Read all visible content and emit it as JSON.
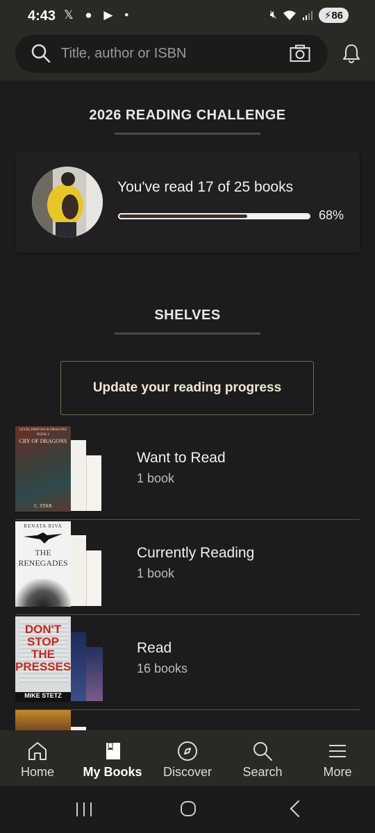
{
  "status_bar": {
    "time": "4:43",
    "battery": "86"
  },
  "search": {
    "placeholder": "Title, author or ISBN"
  },
  "challenge": {
    "title": "2026 READING CHALLENGE",
    "text": "You've read 17 of 25 books",
    "progress_percent": 68,
    "progress_label": "68%"
  },
  "shelves": {
    "title": "SHELVES",
    "update_button": "Update your reading progress",
    "items": [
      {
        "name": "Want to Read",
        "count": "1 book",
        "cover_title": "CRY OF DRAGONS",
        "cover_series": "LEVEL DRIEVES & DRAGONS",
        "cover_book": "BOOK 3",
        "cover_author": "C. STAR"
      },
      {
        "name": "Currently Reading",
        "count": "1 book",
        "cover_title": "THE RENEGADES",
        "cover_author": "RENATA RIVA"
      },
      {
        "name": "Read",
        "count": "16 books",
        "cover_title": "DON'T STOP THE PRESSES",
        "cover_author": "MIKE STETZ"
      }
    ]
  },
  "bottom_nav": [
    {
      "label": "Home",
      "icon": "home-icon"
    },
    {
      "label": "My Books",
      "icon": "book-icon"
    },
    {
      "label": "Discover",
      "icon": "compass-icon"
    },
    {
      "label": "Search",
      "icon": "search-icon"
    },
    {
      "label": "More",
      "icon": "menu-icon"
    }
  ],
  "colors": {
    "background": "#1c1c1c",
    "header": "#2a2924",
    "accent_border": "#7a6a54",
    "progress_fill": "#3f2f24"
  }
}
